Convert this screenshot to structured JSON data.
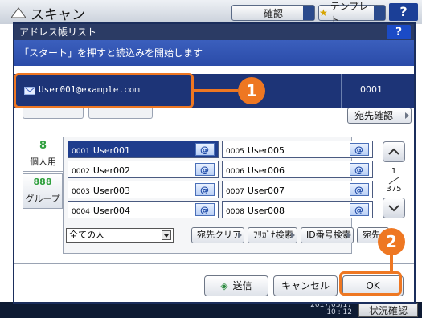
{
  "background": {
    "title": "スキャン",
    "confirm_label": "確認",
    "template_label": "テンプレート",
    "help_label": "?",
    "clock": "2017/03/17\n10 : 12",
    "status_label": "状況確認"
  },
  "dialog": {
    "title": "アドレス帳リスト",
    "help_label": "?",
    "message": "「スタート」を押すと読込みを開始します"
  },
  "selected_address": {
    "email": "User001@example.com",
    "count": "0001",
    "confirm_button": "宛先確認"
  },
  "tabs": [
    {
      "label": "個人用",
      "icon": "person-icon"
    },
    {
      "label": "グループ",
      "icon": "group-icon"
    }
  ],
  "contacts": [
    {
      "num": "0001",
      "name": "User001",
      "selected": true
    },
    {
      "num": "0005",
      "name": "User005",
      "selected": false
    },
    {
      "num": "0002",
      "name": "User002",
      "selected": false
    },
    {
      "num": "0006",
      "name": "User006",
      "selected": false
    },
    {
      "num": "0003",
      "name": "User003",
      "selected": false
    },
    {
      "num": "0007",
      "name": "User007",
      "selected": false
    },
    {
      "num": "0004",
      "name": "User004",
      "selected": false
    },
    {
      "num": "0008",
      "name": "User008",
      "selected": false
    }
  ],
  "paging": {
    "current": "1",
    "total": "375"
  },
  "filter": {
    "selected": "全ての人"
  },
  "actions": {
    "clear": "宛先クリア",
    "furigana": "ﾌﾘｶﾞﾅ検索",
    "id_search": "ID番号検索",
    "dest_search": "宛先"
  },
  "footer": {
    "send": "送信",
    "cancel": "キャンセル",
    "ok": "OK"
  },
  "callouts": {
    "one": "1",
    "two": "2"
  },
  "colors": {
    "accent": "#ee7722",
    "dialog_header": "#2b3b64",
    "selected": "#1f3d8d"
  }
}
